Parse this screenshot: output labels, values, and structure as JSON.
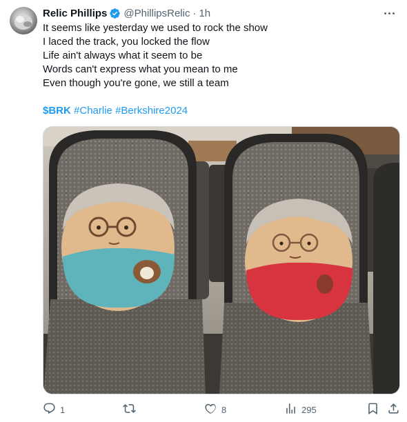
{
  "author": {
    "name": "Relic Phillips",
    "handle": "@PhillipsRelic",
    "separator": "·",
    "time": "1h"
  },
  "tweet": {
    "lines": [
      "It seems like yesterday we used to rock the show",
      "I laced the track, you locked the flow",
      "Life ain't always what it seem to be",
      "Words can't express what you mean to me",
      "Even though you're gone, we still a team"
    ],
    "tags": [
      "$BRK",
      "#Charlie",
      "#Berkshire2024"
    ]
  },
  "actions": {
    "replies": "1",
    "retweets": "",
    "likes": "8",
    "views": "295"
  },
  "icons": {
    "verified": "verified-badge-icon",
    "more": "more-icon",
    "reply": "reply-icon",
    "retweet": "retweet-icon",
    "like": "heart-icon",
    "views": "views-icon",
    "bookmark": "bookmark-icon",
    "share": "share-icon"
  },
  "colors": {
    "accent": "#1d9bf0",
    "muted": "#536471",
    "text": "#0f1419"
  }
}
